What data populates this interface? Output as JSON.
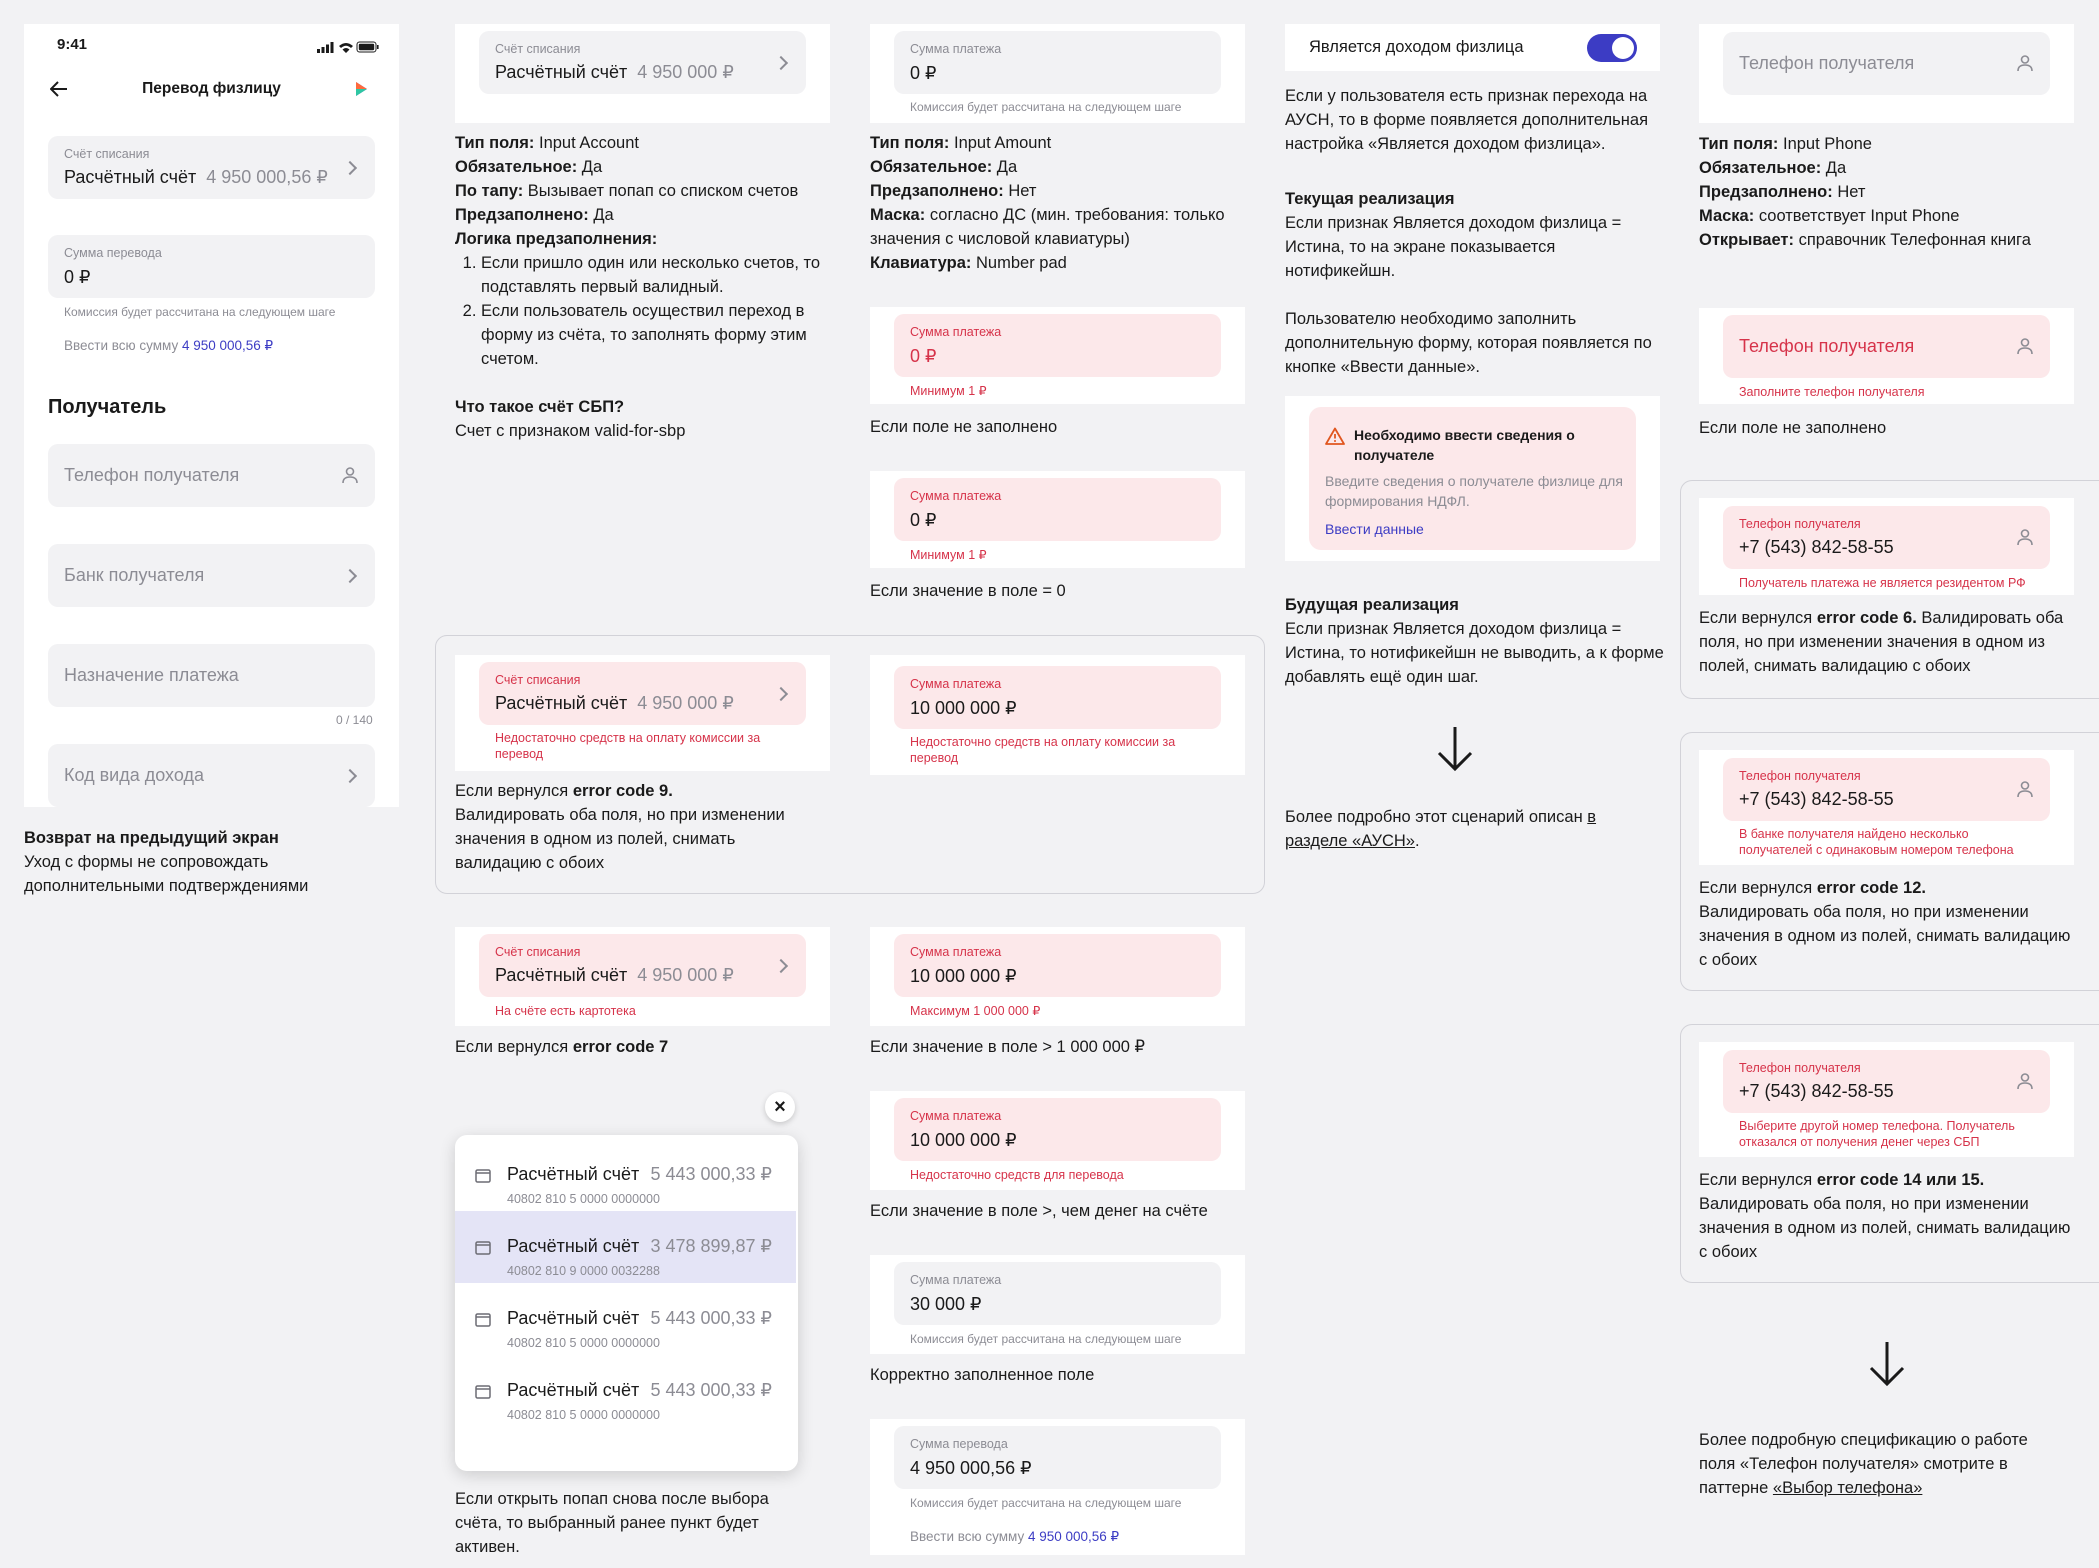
{
  "phone": {
    "time": "9:41",
    "title": "Перевод физлицу",
    "debit": {
      "label": "Счёт списания",
      "name": "Расчётный счёт",
      "amount": "4 950 000,56 ₽"
    },
    "sum": {
      "label": "Сумма перевода",
      "value": "0 ₽",
      "hint": "Комиссия будет рассчитана на следующем шаге",
      "all_prefix": "Ввести всю сумму",
      "all_amount": "4 950 000,56 ₽"
    },
    "section_title": "Получатель",
    "phone_field": "Телефон получателя",
    "bank_field": "Банк получателя",
    "purpose_field": "Назначение платежа",
    "purpose_counter": "0 / 140",
    "income_code_field": "Код вида дохода"
  },
  "back_note": {
    "title": "Возврат на предыдущий экран",
    "text": "Уход с формы не сопровождать дополнительными подтверждениями"
  },
  "account_col": {
    "field": {
      "label": "Счёт списания",
      "name": "Расчётный счёт",
      "amount": "4 950 000 ₽"
    },
    "spec": {
      "type_k": "Тип поля:",
      "type_v": "Input Account",
      "req_k": "Обязательное:",
      "req_v": "Да",
      "tap_k": "По тапу:",
      "tap_v": "Вызывает попап со списком счетов",
      "pre_k": "Предзаполнено:",
      "pre_v": "Да",
      "logic_k": "Логика предзаполнения:",
      "logic_1": "Если пришло один или несколько счетов, то подставлять первый валидный.",
      "logic_2": "Если пользователь осуществил переход в форму из счёта, то заполнять форму этим счетом.",
      "sbp_q": "Что такое счёт СБП?",
      "sbp_a": "Счет с признаком valid-for-sbp"
    },
    "err9": {
      "label": "Счёт списания",
      "name": "Расчётный счёт",
      "amount": "4 950 000 ₽",
      "msg": "Недостаточно средств на оплату комиссии за перевод"
    },
    "err9_note_pre": "Если вернулся",
    "err9_code": "error code 9.",
    "err9_note": "Валидировать оба поля, но при изменении значения в одном из полей, снимать валидацию с обоих",
    "err7": {
      "label": "Счёт списания",
      "name": "Расчётный счёт",
      "amount": "4 950 000 ₽",
      "msg": "На счёте есть картотека"
    },
    "err7_note_pre": "Если вернулся",
    "err7_code": "error code 7",
    "close_glyph": "×",
    "popup": [
      {
        "name": "Расчётный счёт",
        "amount": "5 443 000,33 ₽",
        "num": "40802 810 5 0000 0000000"
      },
      {
        "name": "Расчётный счёт",
        "amount": "3 478 899,87 ₽",
        "num": "40802 810 9 0000 0032288"
      },
      {
        "name": "Расчётный счёт",
        "amount": "5 443 000,33 ₽",
        "num": "40802 810 5 0000 0000000"
      },
      {
        "name": "Расчётный счёт",
        "amount": "5 443 000,33 ₽",
        "num": "40802 810 5 0000 0000000"
      }
    ],
    "popup_note": "Если открыть попап снова после выбора счёта, то выбранный ранее пункт будет активен."
  },
  "amount_col": {
    "field": {
      "label": "Сумма платежа",
      "value": "0 ₽",
      "hint": "Комиссия будет рассчитана на следующем шаге"
    },
    "spec": {
      "type_k": "Тип поля:",
      "type_v": "Input Amount",
      "req_k": "Обязательное:",
      "req_v": "Да",
      "pre_k": "Предзаполнено:",
      "pre_v": "Нет",
      "mask_k": "Маска:",
      "mask_v": "согласно ДС (мин. требования: только значения с числовой клавиатуры)",
      "kb_k": "Клавиатура:",
      "kb_v": "Number pad"
    },
    "empty": {
      "label": "Сумма платежа",
      "value": "0 ₽",
      "msg": "Минимум 1 ₽",
      "note": "Если поле не заполнено"
    },
    "zero": {
      "label": "Сумма платежа",
      "value": "0 ₽",
      "msg": "Минимум 1 ₽",
      "note": "Если значение в поле = 0"
    },
    "err9": {
      "label": "Сумма платежа",
      "value": "10 000 000 ₽",
      "msg": "Недостаточно средств на оплату комиссии за перевод"
    },
    "max": {
      "label": "Сумма платежа",
      "value": "10 000 000 ₽",
      "msg": "Максимум 1 000 000 ₽",
      "note": "Если значение в поле > 1 000 000 ₽"
    },
    "funds": {
      "label": "Сумма платежа",
      "value": "10 000 000 ₽",
      "msg": "Недостаточно средств для перевода",
      "note": "Если значение в поле >, чем денег на счёте"
    },
    "ok": {
      "label": "Сумма платежа",
      "value": "30 000 ₽",
      "hint": "Комиссия будет рассчитана на следующем шаге",
      "note": "Корректно заполненное поле"
    },
    "full": {
      "label": "Сумма перевода",
      "value": "4 950 000,56 ₽",
      "hint": "Комиссия будет рассчитана на следующем шаге",
      "all_prefix": "Ввести всю сумму",
      "all_amount": "4 950 000,56 ₽"
    }
  },
  "income_col": {
    "toggle_label": "Является доходом физлица",
    "toggle_on": true,
    "intro": "Если у пользователя есть признак перехода на АУСН, то в форме появляется дополнительная настройка «Является доходом физлица».",
    "current_title": "Текущая реализация",
    "current_text": "Если признак Является доходом физлица = Истина, то на экране показывается нотификейшн.",
    "current_text2": "Пользователю необходимо заполнить дополнительную форму, которая появляется по кнопке «Ввести данные».",
    "notif_title": "Необходимо ввести сведения о получателе",
    "notif_text": "Введите сведения о получателе физлице для формирования НДФЛ.",
    "notif_link": "Ввести данные",
    "future_title": "Будущая реализация",
    "future_text": "Если признак Является доходом физлица = Истина, то нотификейшн не выводить, а к форме добавлять ещё один шаг.",
    "more_text": "Более подробно этот сценарий описан",
    "more_link": "в разделе «АУСН»",
    "more_dot": "."
  },
  "phone_col": {
    "field": {
      "placeholder": "Телефон получателя"
    },
    "spec": {
      "type_k": "Тип поля:",
      "type_v": "Input Phone",
      "req_k": "Обязательное:",
      "req_v": "Да",
      "pre_k": "Предзаполнено:",
      "pre_v": "Нет",
      "mask_k": "Маска:",
      "mask_v": "соответствует Input Phone",
      "open_k": "Открывает:",
      "open_v": "справочник Телефонная книга"
    },
    "empty": {
      "placeholder": "Телефон получателя",
      "msg": "Заполните телефон получателя",
      "note": "Если поле не заполнено"
    },
    "e6": {
      "label": "Телефон получателя",
      "value": "+7 (543) 842-58-55",
      "msg": "Получатель платежа не является резидентом РФ",
      "note_pre": "Если вернулся",
      "code": "error code 6.",
      "note": "Валидировать оба поля, но при изменении значения в одном из полей, снимать валидацию с обоих"
    },
    "e12": {
      "label": "Телефон получателя",
      "value": "+7 (543) 842-58-55",
      "msg": "В банке получателя найдено несколько получателей с одинаковым номером телефона",
      "note_pre": "Если вернулся",
      "code": "error code 12.",
      "note": "Валидировать оба поля, но при изменении значения в одном из полей, снимать валидацию с обоих"
    },
    "e14": {
      "label": "Телефон получателя",
      "value": "+7 (543) 842-58-55",
      "msg": "Выберите другой номер телефона. Получатель отказался от получения денег через СБП",
      "note_pre": "Если вернулся",
      "code": "error code 14 или 15.",
      "note": "Валидировать оба поля, но при изменении значения в одном из полей, снимать валидацию с обоих"
    },
    "more_text": "Более подробную спецификацию о работе поля «Телефон получателя» смотрите в паттерне",
    "more_link": "«Выбор телефона»"
  },
  "colors": {
    "accent": "#3c3cc4",
    "error": "#d6334a",
    "error_bg": "#fce8ea",
    "field_bg": "#f2f2f4",
    "selected_bg": "#e4e4f6"
  }
}
